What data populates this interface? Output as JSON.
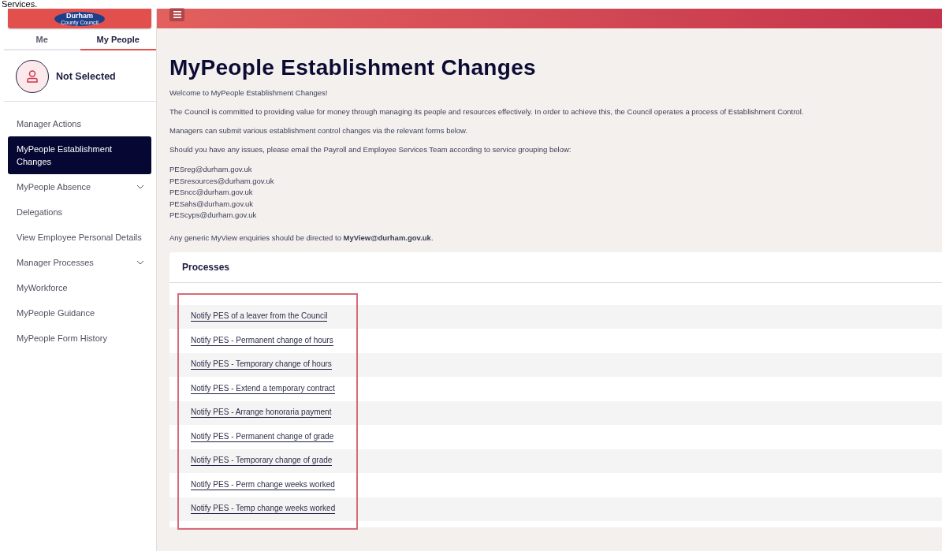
{
  "caption": "Services.",
  "logo": {
    "name": "Durham",
    "subtitle": "County Council"
  },
  "tabs": [
    {
      "label": "Me",
      "selected": false
    },
    {
      "label": "My People",
      "selected": true
    }
  ],
  "profile": {
    "name": "Not Selected"
  },
  "sidebar": {
    "items": [
      {
        "label": "Manager Actions",
        "kind": "link",
        "selected": false
      },
      {
        "label": "MyPeople Establishment Changes",
        "kind": "link",
        "selected": true
      },
      {
        "label": "MyPeople Absence",
        "kind": "group",
        "selected": false
      },
      {
        "label": "Delegations",
        "kind": "link",
        "selected": false
      },
      {
        "label": "View Employee Personal Details",
        "kind": "link",
        "selected": false
      },
      {
        "label": "Manager Processes",
        "kind": "group",
        "selected": false
      },
      {
        "label": "MyWorkforce",
        "kind": "link",
        "selected": false
      },
      {
        "label": "MyPeople Guidance",
        "kind": "link",
        "selected": false
      },
      {
        "label": "MyPeople Form History",
        "kind": "link",
        "selected": false
      }
    ]
  },
  "page": {
    "title": "MyPeople Establishment Changes",
    "paragraphs": [
      "Welcome to MyPeople Establishment Changes!",
      "The Council is committed to providing value for money through managing its people and resources effectively. In order to achieve this, the Council operates a process of Establishment Control.",
      "Managers can submit various establishment control changes via the relevant forms below.",
      "Should you have any issues, please email the Payroll and Employee Services Team according to service grouping below:"
    ],
    "emails": [
      "PESreg@durham.gov.uk",
      "PESresources@durham.gov.uk",
      "PESncc@durham.gov.uk",
      "PESahs@durham.gov.uk",
      "PEScyps@durham.gov.uk"
    ],
    "footer_note": "Any generic MyView enquiries should be directed to **MyView@durham.gov.uk**."
  },
  "processes": {
    "title": "Processes",
    "links": [
      "Notify PES of a leaver from the Council",
      "Notify PES - Permanent change of hours",
      "Notify PES - Temporary change of hours",
      "Notify PES - Extend a temporary contract",
      "Notify PES - Arrange honoraria payment",
      "Notify PES - Permanent change of grade",
      "Notify PES - Temporary change of grade",
      "Notify PES - Perm change weeks worked",
      "Notify PES - Temp change weeks worked"
    ]
  }
}
